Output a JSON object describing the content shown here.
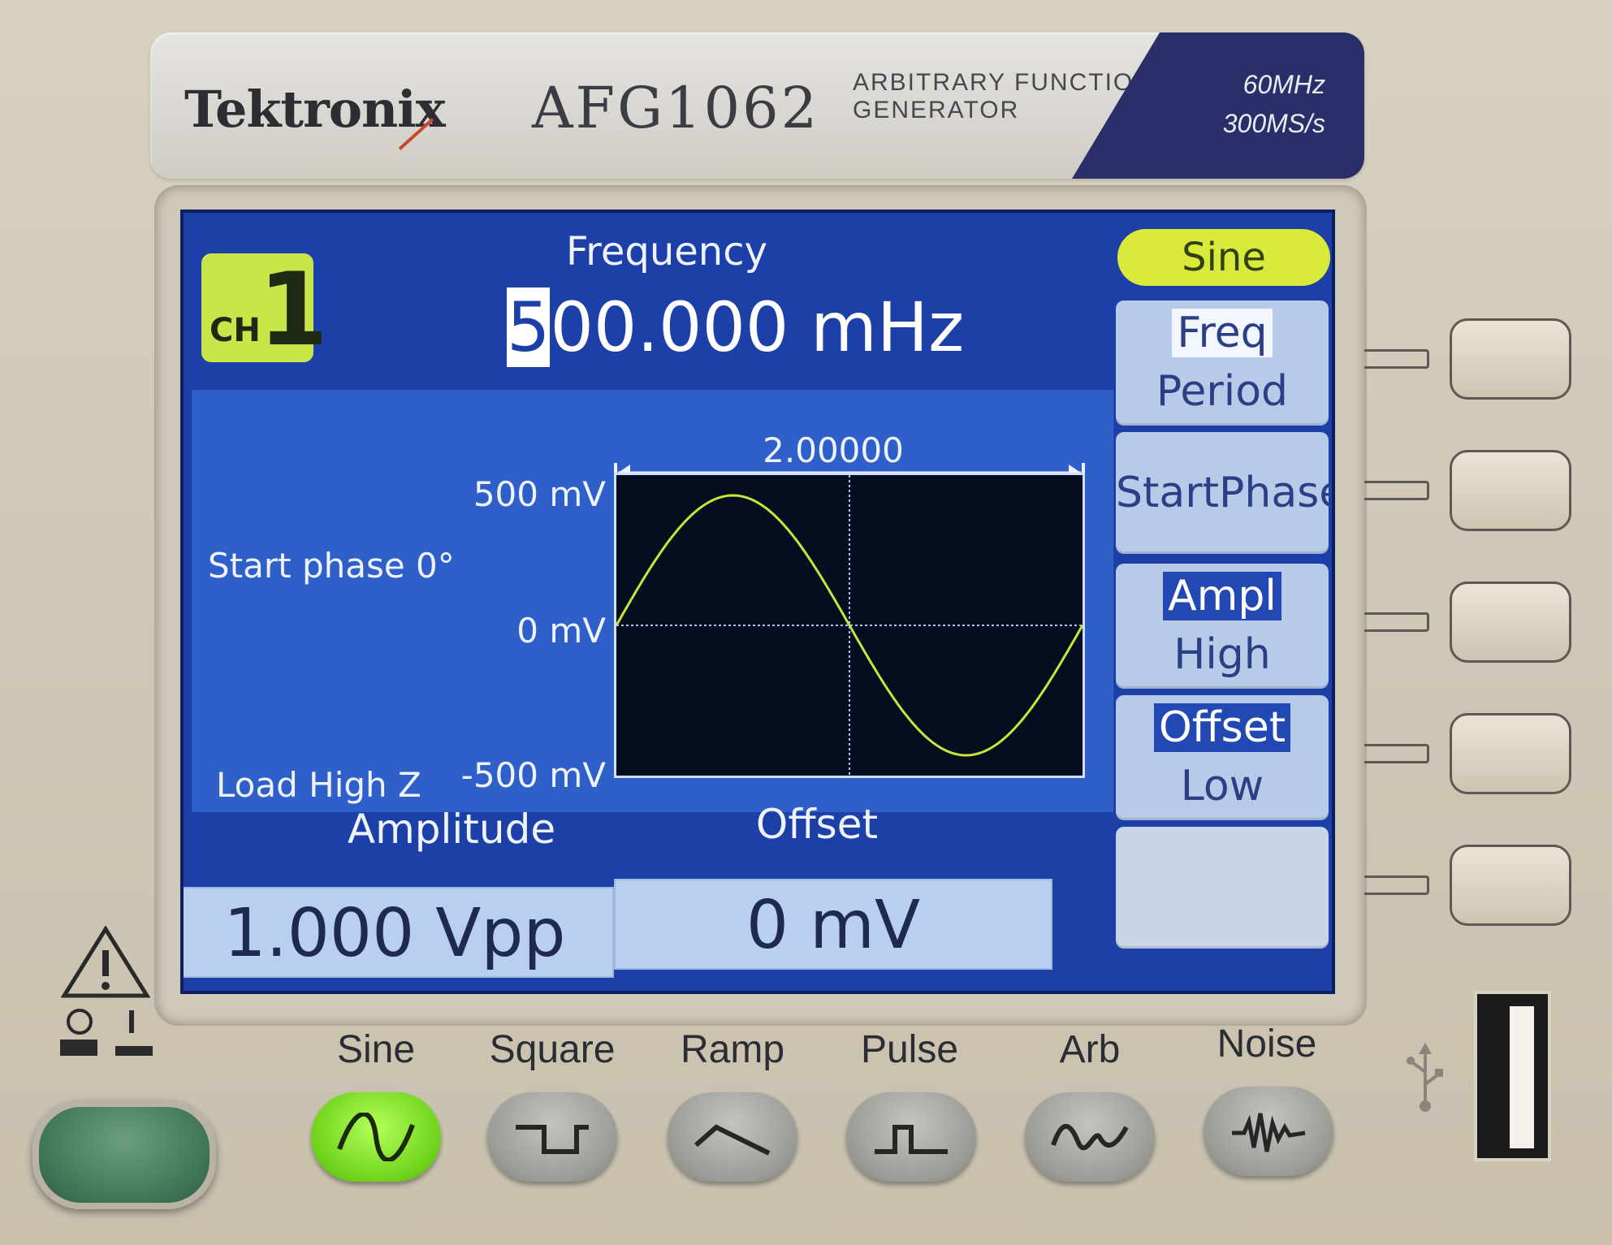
{
  "brand": {
    "logo": "Tektronix",
    "model": "AFG1062",
    "description": "ARBITRARY FUNCTION\nGENERATOR",
    "specs": "60MHz\n300MS/s"
  },
  "channel": {
    "label": "CH",
    "number": "1"
  },
  "frequency": {
    "title": "Frequency",
    "cursor_digit": "5",
    "value_rest": "00.000 mHz"
  },
  "waveform": {
    "period": "2.00000 s",
    "y_top": "500 mV",
    "y_mid": "0 mV",
    "y_bottom": "-500 mV",
    "start_phase": "Start phase 0°",
    "load": "Load High Z",
    "trace_color": "#c8e63a"
  },
  "fields": {
    "amplitude_title": "Amplitude",
    "amplitude_value": "1.000 Vpp",
    "offset_title": "Offset",
    "offset_value": "0 mV"
  },
  "menu": {
    "wave_type": "Sine",
    "freq": "Freq",
    "period": "Period",
    "start_phase": "StartPhase",
    "ampl": "Ampl",
    "high": "High",
    "offset": "Offset",
    "low": "Low"
  },
  "buttons": {
    "sine": "Sine",
    "square": "Square",
    "ramp": "Ramp",
    "pulse": "Pulse",
    "arb": "Arb",
    "noise": "Noise",
    "active": "Sine"
  },
  "colors": {
    "screen": "#1d3fa8",
    "active_button": "#6fd31b",
    "channel_badge": "#c8e64a"
  }
}
